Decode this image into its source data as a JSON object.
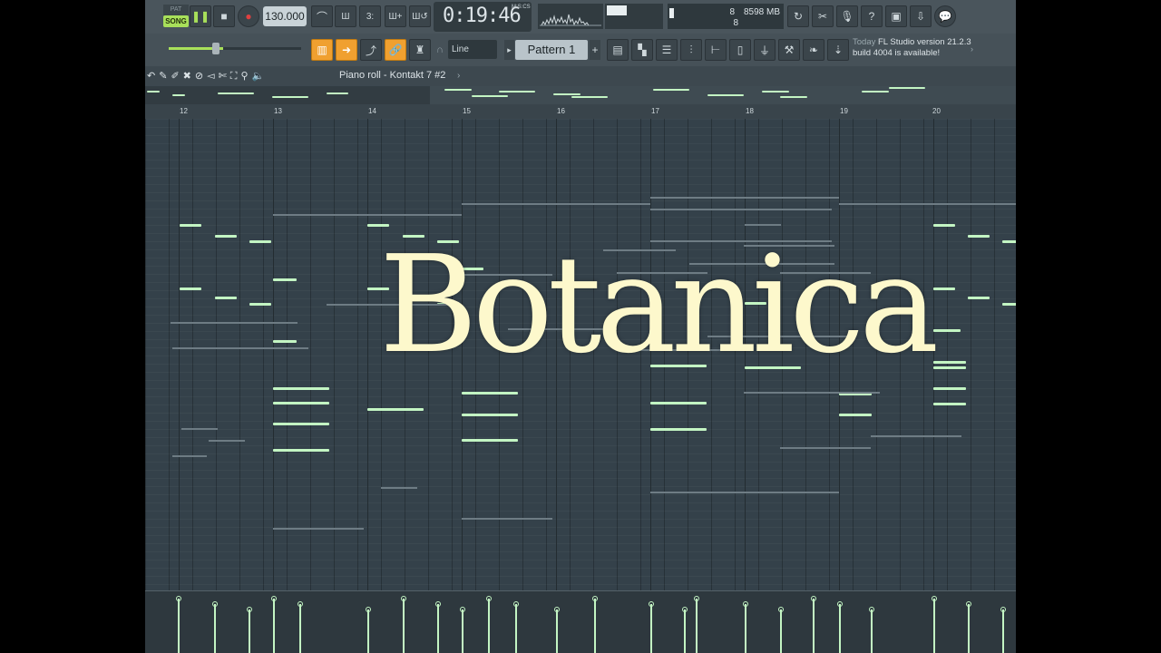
{
  "toolbar": {
    "pat_label": "PAT",
    "song_label": "SONG",
    "tempo": "130.000",
    "time": "0:19:46",
    "time_unit_label": "M:S:CS",
    "cpu_value": "8",
    "memory": "8598 MB",
    "poly_count": "8",
    "snap_mode": "Line",
    "pattern_name": "Pattern 1",
    "news_when": "Today",
    "news_text": "FL Studio version 21.2.3 build 4004 is available!"
  },
  "piano_roll": {
    "title": "Piano roll - Kontakt 7 #2",
    "bars": [
      "12",
      "13",
      "14",
      "15",
      "16",
      "17",
      "18",
      "19",
      "20"
    ]
  },
  "overlay": {
    "title": "Botanica"
  },
  "colors": {
    "accent": "#a8e05a",
    "note": "#c3f5c3",
    "title": "#fdf8cc",
    "background": "#34414a"
  }
}
